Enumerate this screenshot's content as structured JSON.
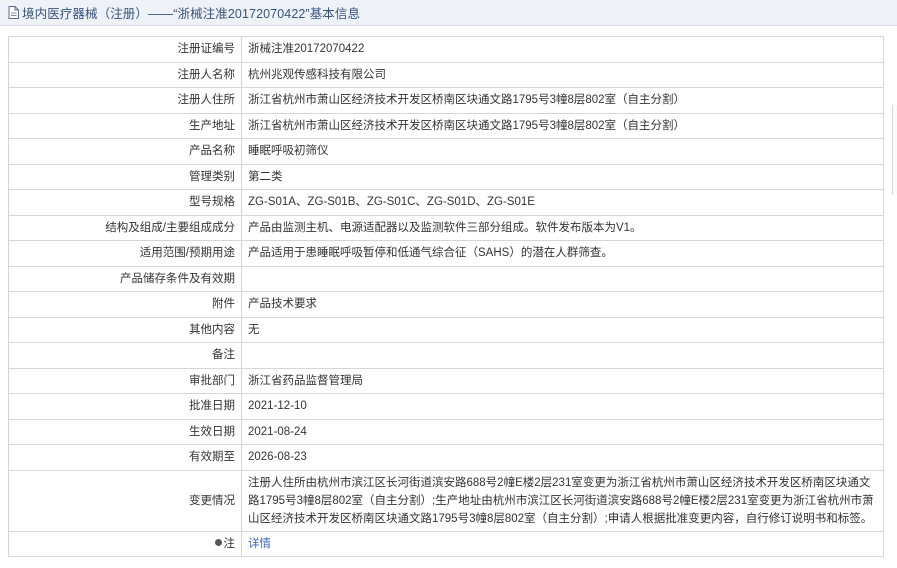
{
  "header": {
    "title": "境内医疗器械（注册）——“浙械注准20172070422”基本信息",
    "icon": "document-icon"
  },
  "rows": [
    {
      "label": "注册证编号",
      "value": "浙械注准20172070422"
    },
    {
      "label": "注册人名称",
      "value": "杭州兆观传感科技有限公司"
    },
    {
      "label": "注册人住所",
      "value": "浙江省杭州市萧山区经济技术开发区桥南区块通文路1795号3幢8层802室（自主分割）"
    },
    {
      "label": "生产地址",
      "value": "浙江省杭州市萧山区经济技术开发区桥南区块通文路1795号3幢8层802室（自主分割）"
    },
    {
      "label": "产品名称",
      "value": "睡眠呼吸初筛仪"
    },
    {
      "label": "管理类别",
      "value": "第二类"
    },
    {
      "label": "型号规格",
      "value": "ZG-S01A、ZG-S01B、ZG-S01C、ZG-S01D、ZG-S01E"
    },
    {
      "label": "结构及组成/主要组成成分",
      "value": "产品由监测主机、电源适配器以及监测软件三部分组成。软件发布版本为V1。"
    },
    {
      "label": "适用范围/预期用途",
      "value": "产品适用于患睡眠呼吸暂停和低通气综合征（SAHS）的潜在人群筛查。"
    },
    {
      "label": "产品储存条件及有效期",
      "value": ""
    },
    {
      "label": "附件",
      "value": "产品技术要求"
    },
    {
      "label": "其他内容",
      "value": "无"
    },
    {
      "label": "备注",
      "value": ""
    },
    {
      "label": "审批部门",
      "value": "浙江省药品监督管理局"
    },
    {
      "label": "批准日期",
      "value": "2021-12-10"
    },
    {
      "label": "生效日期",
      "value": "2021-08-24"
    },
    {
      "label": "有效期至",
      "value": "2026-08-23"
    },
    {
      "label": "变更情况",
      "value": "注册人住所由杭州市滨江区长河街道滨安路688号2幢E楼2层231室变更为浙江省杭州市萧山区经济技术开发区桥南区块通文路1795号3幢8层802室（自主分割）;生产地址由杭州市滨江区长河街道滨安路688号2幢E楼2层231室变更为浙江省杭州市萧山区经济技术开发区桥南区块通文路1795号3幢8层802室（自主分割）;申请人根据批准变更内容，自行修订说明书和标签。"
    }
  ],
  "note": {
    "label": "注",
    "link_text": "详情",
    "icon": "bulb-icon"
  }
}
